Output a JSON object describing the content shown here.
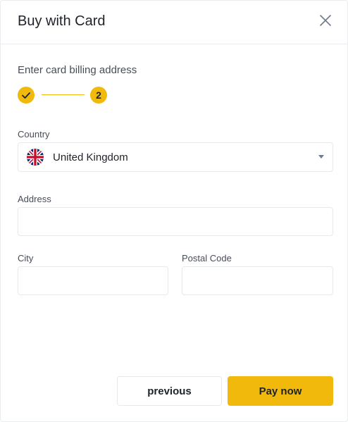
{
  "dialog": {
    "title": "Buy with Card",
    "close_icon": "close-icon"
  },
  "billing": {
    "heading": "Enter card billing address",
    "steps": [
      {
        "state": "completed",
        "icon": "check-icon"
      },
      {
        "state": "current",
        "number": "2"
      }
    ]
  },
  "form": {
    "country": {
      "label": "Country",
      "value": "United Kingdom",
      "flag_icon": "uk-flag-icon",
      "dropdown_icon": "caret-down-icon"
    },
    "address": {
      "label": "Address",
      "value": "",
      "placeholder": ""
    },
    "city": {
      "label": "City",
      "value": "",
      "placeholder": ""
    },
    "postal_code": {
      "label": "Postal Code",
      "value": "",
      "placeholder": ""
    }
  },
  "actions": {
    "previous_label": "previous",
    "pay_label": "Pay now"
  },
  "colors": {
    "accent": "#f0b90b",
    "text": "#1e2329",
    "muted_text": "#474d57",
    "border": "#e6e8ea"
  }
}
